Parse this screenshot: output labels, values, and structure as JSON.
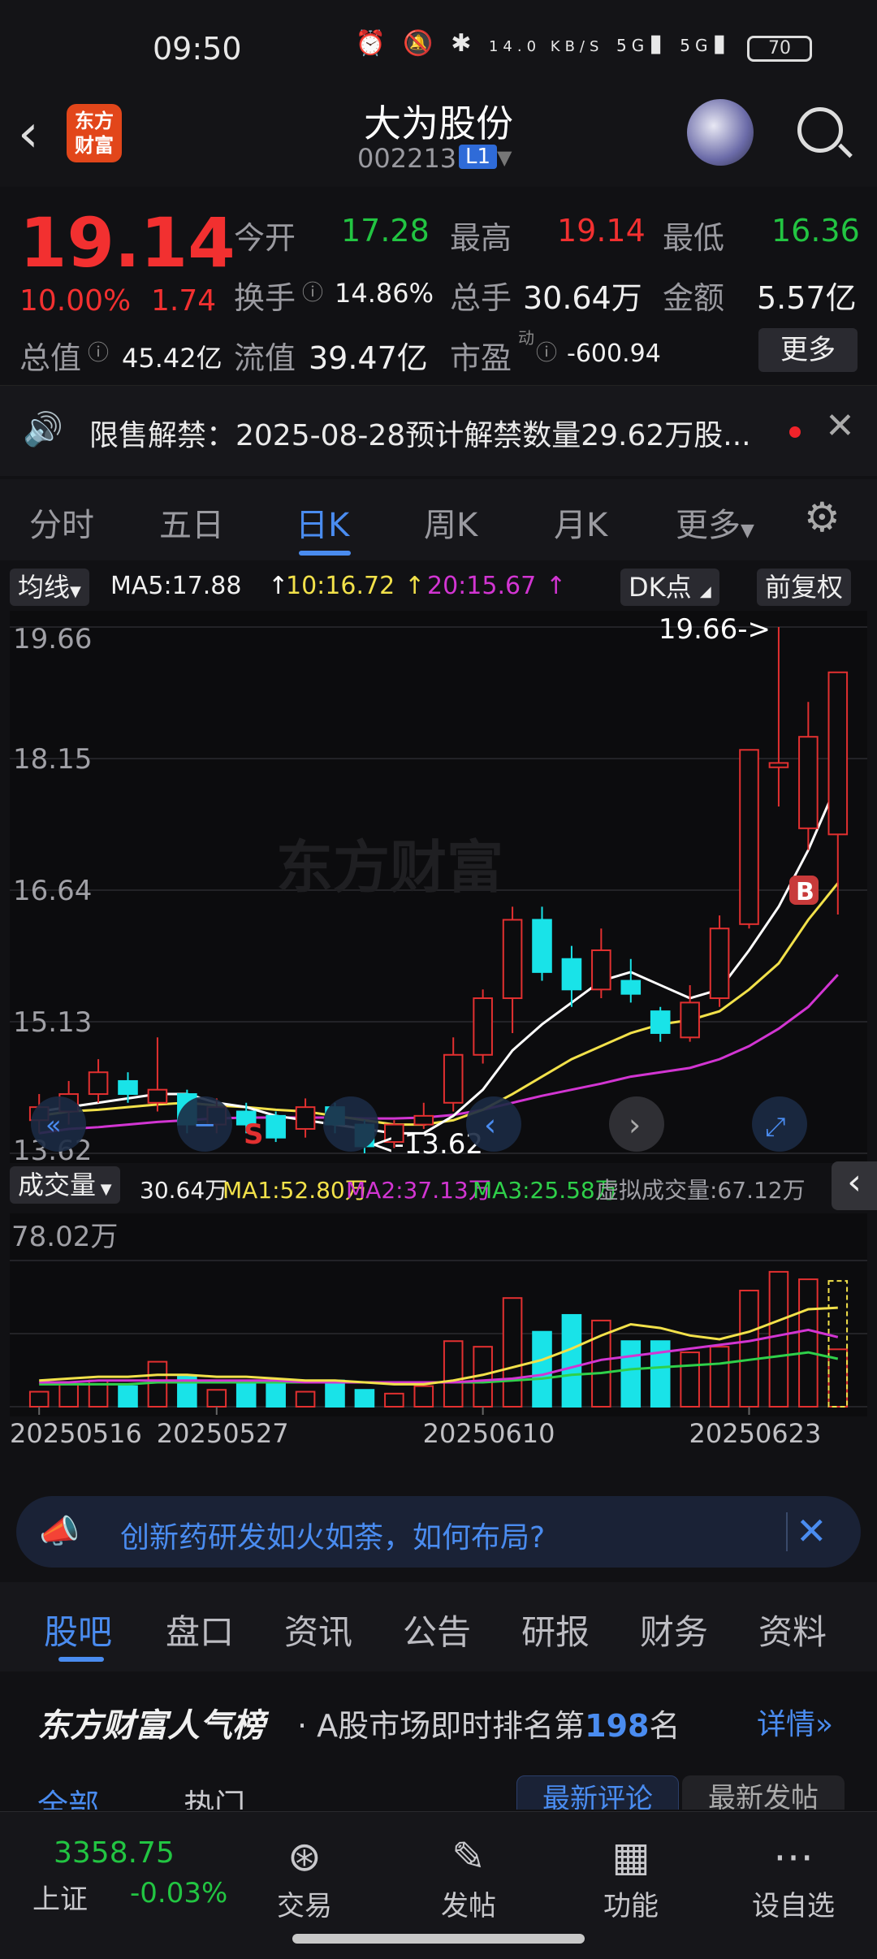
{
  "status_bar": {
    "time": "09:50",
    "net_speed": "14.0 KB/S",
    "signal1": "5G",
    "signal2": "5G",
    "battery": "70"
  },
  "header": {
    "logo_text": "东方财富",
    "stock_name": "大为股份",
    "stock_code": "002213",
    "level_badge": "L1"
  },
  "quote": {
    "price": "19.14",
    "change_pct": "10.00%",
    "change": "1.74",
    "open_label": "今开",
    "open": "17.28",
    "high_label": "最高",
    "high": "19.14",
    "low_label": "最低",
    "low": "16.36",
    "turnover_label": "换手",
    "turnover": "14.86%",
    "volume_label": "总手",
    "volume": "30.64万",
    "amount_label": "金额",
    "amount": "5.57亿",
    "mktcap_label": "总值",
    "mktcap": "45.42亿",
    "float_label": "流值",
    "float_cap": "39.47亿",
    "pe_label": "市盈",
    "pe_sup": "动",
    "pe": "-600.94",
    "more_label": "更多"
  },
  "notice": {
    "text": "限售解禁：2025-08-28预计解禁数量29.62万股..."
  },
  "tabs": [
    "分时",
    "五日",
    "日K",
    "周K",
    "月K",
    "更多"
  ],
  "active_tab": "日K",
  "kline": {
    "ma_selector": "均线",
    "ma5": "MA5:17.88",
    "ma10": "10:16.72",
    "ma20": "20:15.67",
    "dk_label": "DK点",
    "adjust_label": "前复权",
    "high_marker": "19.66->",
    "low_marker": "<-13.62",
    "watermark": "东方财富",
    "sell_marker": "S",
    "buy_marker": "B"
  },
  "volume": {
    "selector": "成交量",
    "vol": "30.64万",
    "ma1": "MA1:52.80万",
    "ma2": "MA2:37.13万",
    "ma3": "MA3:25.58万",
    "virtual": "虚拟成交量:67.12万",
    "ymax": "78.02万"
  },
  "chart_data": [
    {
      "type": "candlestick",
      "title": "",
      "y_ticks": [
        "19.66",
        "18.15",
        "16.64",
        "15.13",
        "13.62"
      ],
      "ylim": [
        13.62,
        19.66
      ],
      "x_ticks": [
        "20250516",
        "20250527",
        "20250610",
        "20250623"
      ],
      "candles": [
        {
          "o": 14.0,
          "c": 14.15,
          "h": 14.3,
          "l": 13.85
        },
        {
          "o": 14.1,
          "c": 14.3,
          "h": 14.45,
          "l": 13.95
        },
        {
          "o": 14.3,
          "c": 14.55,
          "h": 14.7,
          "l": 14.2
        },
        {
          "o": 14.45,
          "c": 14.3,
          "h": 14.55,
          "l": 14.2
        },
        {
          "o": 14.2,
          "c": 14.35,
          "h": 14.95,
          "l": 14.1
        },
        {
          "o": 14.3,
          "c": 13.95,
          "h": 14.35,
          "l": 13.85
        },
        {
          "o": 13.95,
          "c": 14.15,
          "h": 14.25,
          "l": 13.85
        },
        {
          "o": 14.1,
          "c": 13.95,
          "h": 14.2,
          "l": 13.85
        },
        {
          "o": 14.05,
          "c": 13.8,
          "h": 14.1,
          "l": 13.75
        },
        {
          "o": 13.9,
          "c": 14.15,
          "h": 14.25,
          "l": 13.8
        },
        {
          "o": 14.15,
          "c": 13.95,
          "h": 14.2,
          "l": 13.85
        },
        {
          "o": 13.95,
          "c": 13.7,
          "h": 14.0,
          "l": 13.62
        },
        {
          "o": 13.75,
          "c": 13.95,
          "h": 14.0,
          "l": 13.68
        },
        {
          "o": 13.95,
          "c": 14.05,
          "h": 14.2,
          "l": 13.9
        },
        {
          "o": 14.2,
          "c": 14.75,
          "h": 14.95,
          "l": 14.1
        },
        {
          "o": 14.75,
          "c": 15.4,
          "h": 15.5,
          "l": 14.65
        },
        {
          "o": 15.4,
          "c": 16.3,
          "h": 16.45,
          "l": 15.0
        },
        {
          "o": 16.3,
          "c": 15.7,
          "h": 16.45,
          "l": 15.6
        },
        {
          "o": 15.85,
          "c": 15.5,
          "h": 16.0,
          "l": 15.3
        },
        {
          "o": 15.5,
          "c": 15.95,
          "h": 16.2,
          "l": 15.4
        },
        {
          "o": 15.6,
          "c": 15.45,
          "h": 15.85,
          "l": 15.35
        },
        {
          "o": 15.25,
          "c": 15.0,
          "h": 15.3,
          "l": 14.9
        },
        {
          "o": 14.95,
          "c": 15.35,
          "h": 15.55,
          "l": 14.9
        },
        {
          "o": 15.4,
          "c": 16.2,
          "h": 16.35,
          "l": 15.3
        },
        {
          "o": 16.25,
          "c": 18.25,
          "h": 18.25,
          "l": 16.2
        },
        {
          "o": 18.05,
          "c": 18.1,
          "h": 19.66,
          "l": 17.6
        },
        {
          "o": 17.35,
          "c": 18.4,
          "h": 18.8,
          "l": 17.1
        },
        {
          "o": 17.28,
          "c": 19.14,
          "h": 19.14,
          "l": 16.36
        }
      ],
      "ma5": [
        14.1,
        14.15,
        14.2,
        14.25,
        14.3,
        14.3,
        14.2,
        14.15,
        14.05,
        14.0,
        13.95,
        13.9,
        13.85,
        13.85,
        14.05,
        14.35,
        14.8,
        15.1,
        15.35,
        15.6,
        15.7,
        15.55,
        15.4,
        15.5,
        15.95,
        16.45,
        17.1,
        17.88
      ],
      "ma10": [
        14.05,
        14.1,
        14.12,
        14.15,
        14.18,
        14.2,
        14.17,
        14.15,
        14.12,
        14.1,
        14.05,
        14.0,
        13.95,
        13.95,
        14.0,
        14.12,
        14.3,
        14.5,
        14.7,
        14.85,
        15.0,
        15.1,
        15.15,
        15.25,
        15.5,
        15.8,
        16.3,
        16.72
      ],
      "ma20": [
        13.85,
        13.9,
        13.92,
        13.95,
        13.98,
        14.0,
        14.02,
        14.03,
        14.03,
        14.03,
        14.03,
        14.02,
        14.02,
        14.03,
        14.06,
        14.12,
        14.2,
        14.28,
        14.35,
        14.42,
        14.5,
        14.55,
        14.6,
        14.7,
        14.85,
        15.05,
        15.3,
        15.67
      ]
    },
    {
      "type": "bar",
      "title": "成交量",
      "ymax": 78.02,
      "unit": "万",
      "values": [
        8,
        12,
        14,
        11,
        24,
        16,
        9,
        13,
        14,
        8,
        14,
        9,
        7,
        11,
        35,
        32,
        58,
        40,
        49,
        46,
        35,
        35,
        29,
        32,
        62,
        72,
        68,
        30.64
      ],
      "virtual_last": 67.12,
      "ma1": [
        14,
        15,
        16,
        16,
        17,
        17,
        16,
        16,
        15,
        14,
        14,
        13,
        12,
        12,
        14,
        17,
        21,
        25,
        31,
        38,
        44,
        42,
        38,
        36,
        40,
        46,
        52,
        52.8
      ],
      "ma2": [
        13,
        13,
        14,
        14,
        14,
        14,
        14,
        14,
        14,
        13,
        13,
        13,
        13,
        13,
        13,
        14,
        15,
        17,
        21,
        25,
        27,
        29,
        31,
        33,
        35,
        38,
        41,
        37.13
      ],
      "ma3": [
        12,
        12,
        12,
        12,
        13,
        13,
        13,
        13,
        13,
        13,
        13,
        13,
        13,
        13,
        13,
        13,
        14,
        15,
        17,
        18,
        20,
        21,
        22,
        23,
        25,
        27,
        29,
        25.58
      ]
    }
  ],
  "promo": {
    "text": "创新药研发如火如荼，如何布局?"
  },
  "bottom_tabs": [
    "股吧",
    "盘口",
    "资讯",
    "公告",
    "研报",
    "财务",
    "资料"
  ],
  "rank": {
    "brand": "东方财富人气榜",
    "desc_prefix": "· A股市场即时排名第",
    "rank_no": "198",
    "desc_suffix": "名",
    "detail": "详情"
  },
  "sub_tabs": {
    "all": "全部",
    "hot": "热门",
    "latest_comment": "最新评论",
    "latest_post": "最新发帖"
  },
  "bottom_nav": {
    "index_value": "3358.75",
    "index_name": "上证",
    "index_change": "-0.03%",
    "trade": "交易",
    "post": "发帖",
    "func": "功能",
    "watch": "设自选"
  }
}
